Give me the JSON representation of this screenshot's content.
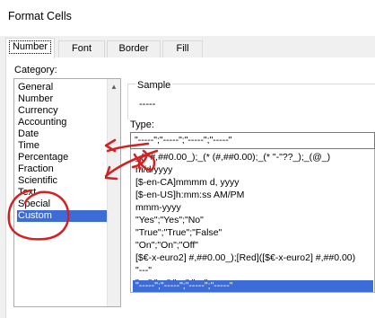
{
  "window": {
    "title": "Format Cells"
  },
  "tabs": [
    {
      "label": "Number",
      "active": true
    },
    {
      "label": "Font",
      "active": false
    },
    {
      "label": "Border",
      "active": false
    },
    {
      "label": "Fill",
      "active": false
    }
  ],
  "category": {
    "label": "Category:",
    "items": [
      "General",
      "Number",
      "Currency",
      "Accounting",
      "Date",
      "Time",
      "Percentage",
      "Fraction",
      "Scientific",
      "Text",
      "Special",
      "Custom"
    ],
    "selected": "Custom"
  },
  "sample": {
    "label": "Sample",
    "value": "-----"
  },
  "type": {
    "label": "Type:",
    "input_value": "\"-----\";\"-----\";\"-----\";\"-----\"",
    "items": [
      "_(* #,##0.00_);_(* (#,##0.00);_(* \"-\"??_);_(@_)",
      "m/d/yyyy",
      "[$-en-CA]mmmm d, yyyy",
      "[$-en-US]h:mm:ss AM/PM",
      "mmm-yyyy",
      "\"Yes\";\"Yes\";\"No\"",
      "\"True\";\"True\";\"False\"",
      "\"On\";\"On\";\"Off\"",
      "[$€-x-euro2] #,##0.00_);[Red]([$€-x-euro2] #,##0.00)",
      "\"---\"",
      "\"---\";\"---\";\"---\";\"---\"",
      "\"-----\";\"-----\";\"-----\";\"-----\""
    ],
    "selected": "\"-----\";\"-----\";\"-----\";\"-----\""
  },
  "colors": {
    "selection": "#3c6cd8",
    "annotation": "#d42020"
  }
}
